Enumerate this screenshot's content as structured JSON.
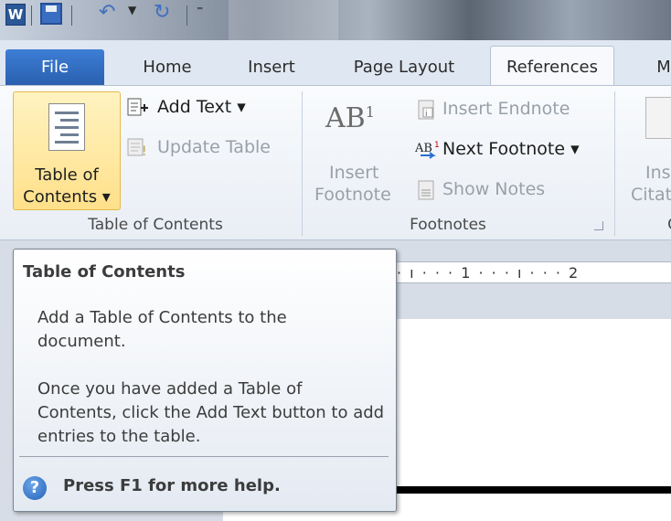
{
  "qat": {
    "app_icon": "W",
    "save_icon": "save-icon",
    "undo_icon": "undo-icon",
    "redo_icon": "redo-icon",
    "more_icon": "⁼"
  },
  "tabs": [
    {
      "label": "File"
    },
    {
      "label": "Home"
    },
    {
      "label": "Insert"
    },
    {
      "label": "Page Layout"
    },
    {
      "label": "References",
      "selected": true
    },
    {
      "label": "M"
    }
  ],
  "ribbon": {
    "toc_group": {
      "big_button": {
        "line1": "Table of",
        "line2": "Contents ▾",
        "icon": "table-of-contents-icon"
      },
      "add_text": "Add Text ▾",
      "update_table": "Update Table",
      "label": "Table of Contents"
    },
    "footnotes_group": {
      "insert_footnote_line1": "Insert",
      "insert_footnote_line2": "Footnote",
      "insert_endnote": "Insert Endnote",
      "next_footnote": "Next Footnote ▾",
      "show_notes": "Show Notes",
      "label": "Footnotes"
    },
    "citations_group": {
      "line1": "Ins",
      "line2": "Citat",
      "label": "C"
    }
  },
  "ruler": {
    "ticks": "· ı · · · 1 · · · ı · · · 2"
  },
  "tooltip": {
    "title": "Table of Contents",
    "body1": "Add a Table of Contents to the document.",
    "body2": "Once you have added a Table of Contents, click the Add Text button to add entries to the table.",
    "help": "Press F1 for more help.",
    "help_icon": "?"
  },
  "colors": {
    "file_tab": "#2a5fae",
    "tooltip_bg": "#ffffff",
    "selected_button": "#ffe08a"
  }
}
